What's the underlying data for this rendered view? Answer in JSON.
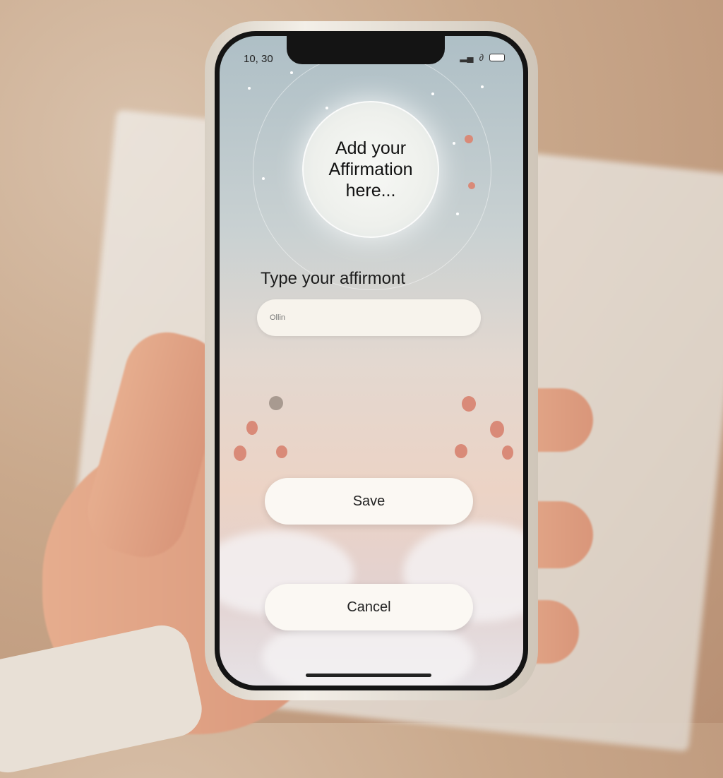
{
  "status_bar": {
    "time": "10, 30",
    "signal_icon": "signal-icon",
    "wifi_icon": "wifi-icon",
    "battery_icon": "battery-icon"
  },
  "hero": {
    "text": "Add your Affirmation here..."
  },
  "form": {
    "label": "Type your affirmont",
    "input_value": "Ollin"
  },
  "buttons": {
    "save": "Save",
    "cancel": "Cancel"
  },
  "colors": {
    "accent_flower": "#d98a78",
    "button_bg": "#fbf8f3"
  }
}
